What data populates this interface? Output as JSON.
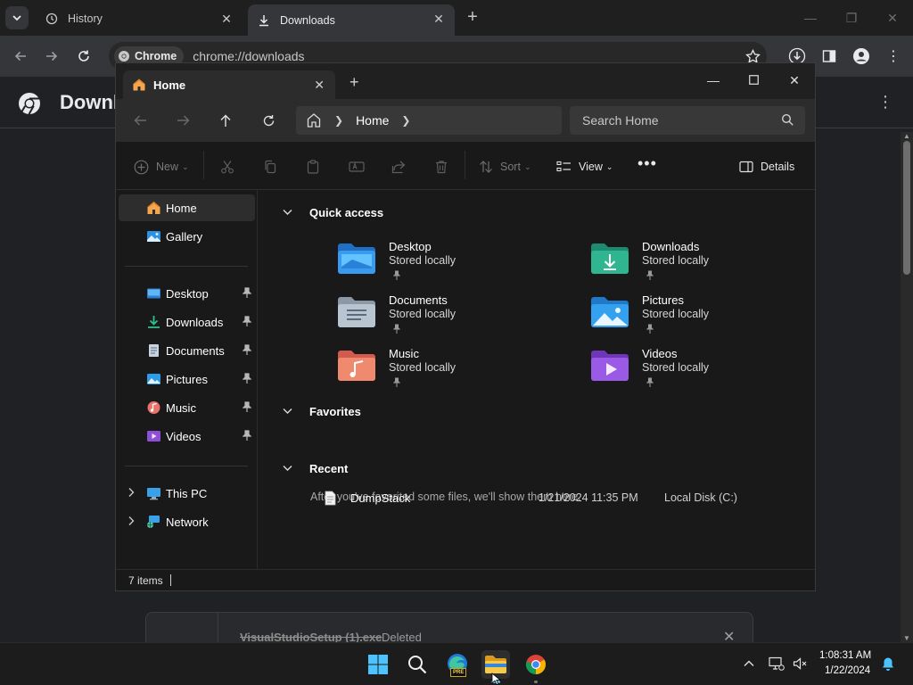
{
  "chrome": {
    "tabs": [
      {
        "label": "History",
        "icon": "history-icon"
      },
      {
        "label": "Downloads",
        "icon": "download-icon"
      }
    ],
    "url_chip": "Chrome",
    "url": "chrome://downloads",
    "page_title": "Downl",
    "download_item": {
      "filename": "VisualStudioSetup (1).exe",
      "status": "Deleted"
    }
  },
  "explorer": {
    "tab_title": "Home",
    "breadcrumb": [
      "Home"
    ],
    "search_placeholder": "Search Home",
    "commands": {
      "new": "New",
      "sort": "Sort",
      "view": "View",
      "details": "Details"
    },
    "nav": {
      "home": "Home",
      "gallery": "Gallery",
      "pinned": [
        {
          "label": "Desktop",
          "icon": "desktop-folder-icon"
        },
        {
          "label": "Downloads",
          "icon": "downloads-folder-icon"
        },
        {
          "label": "Documents",
          "icon": "documents-folder-icon"
        },
        {
          "label": "Pictures",
          "icon": "pictures-folder-icon"
        },
        {
          "label": "Music",
          "icon": "music-folder-icon"
        },
        {
          "label": "Videos",
          "icon": "videos-folder-icon"
        }
      ],
      "this_pc": "This PC",
      "network": "Network"
    },
    "sections": {
      "quick_access": "Quick access",
      "favorites": "Favorites",
      "recent": "Recent"
    },
    "quick_access": [
      {
        "name": "Desktop",
        "sub": "Stored locally"
      },
      {
        "name": "Downloads",
        "sub": "Stored locally"
      },
      {
        "name": "Documents",
        "sub": "Stored locally"
      },
      {
        "name": "Pictures",
        "sub": "Stored locally"
      },
      {
        "name": "Music",
        "sub": "Stored locally"
      },
      {
        "name": "Videos",
        "sub": "Stored locally"
      }
    ],
    "favorites_empty": "After you've favorited some files, we'll show them here.",
    "recent": [
      {
        "name": "DumpStack",
        "date": "1/21/2024 11:35 PM",
        "location": "Local Disk (C:)"
      }
    ],
    "status": "7 items"
  },
  "taskbar": {
    "time": "1:08:31 AM",
    "date": "1/22/2024",
    "edge_badge": "PRE"
  },
  "colors": {
    "accent_blue": "#4cc2ff",
    "folder_yellow": "#f0c14b",
    "downloads_green": "#2aa58f"
  }
}
